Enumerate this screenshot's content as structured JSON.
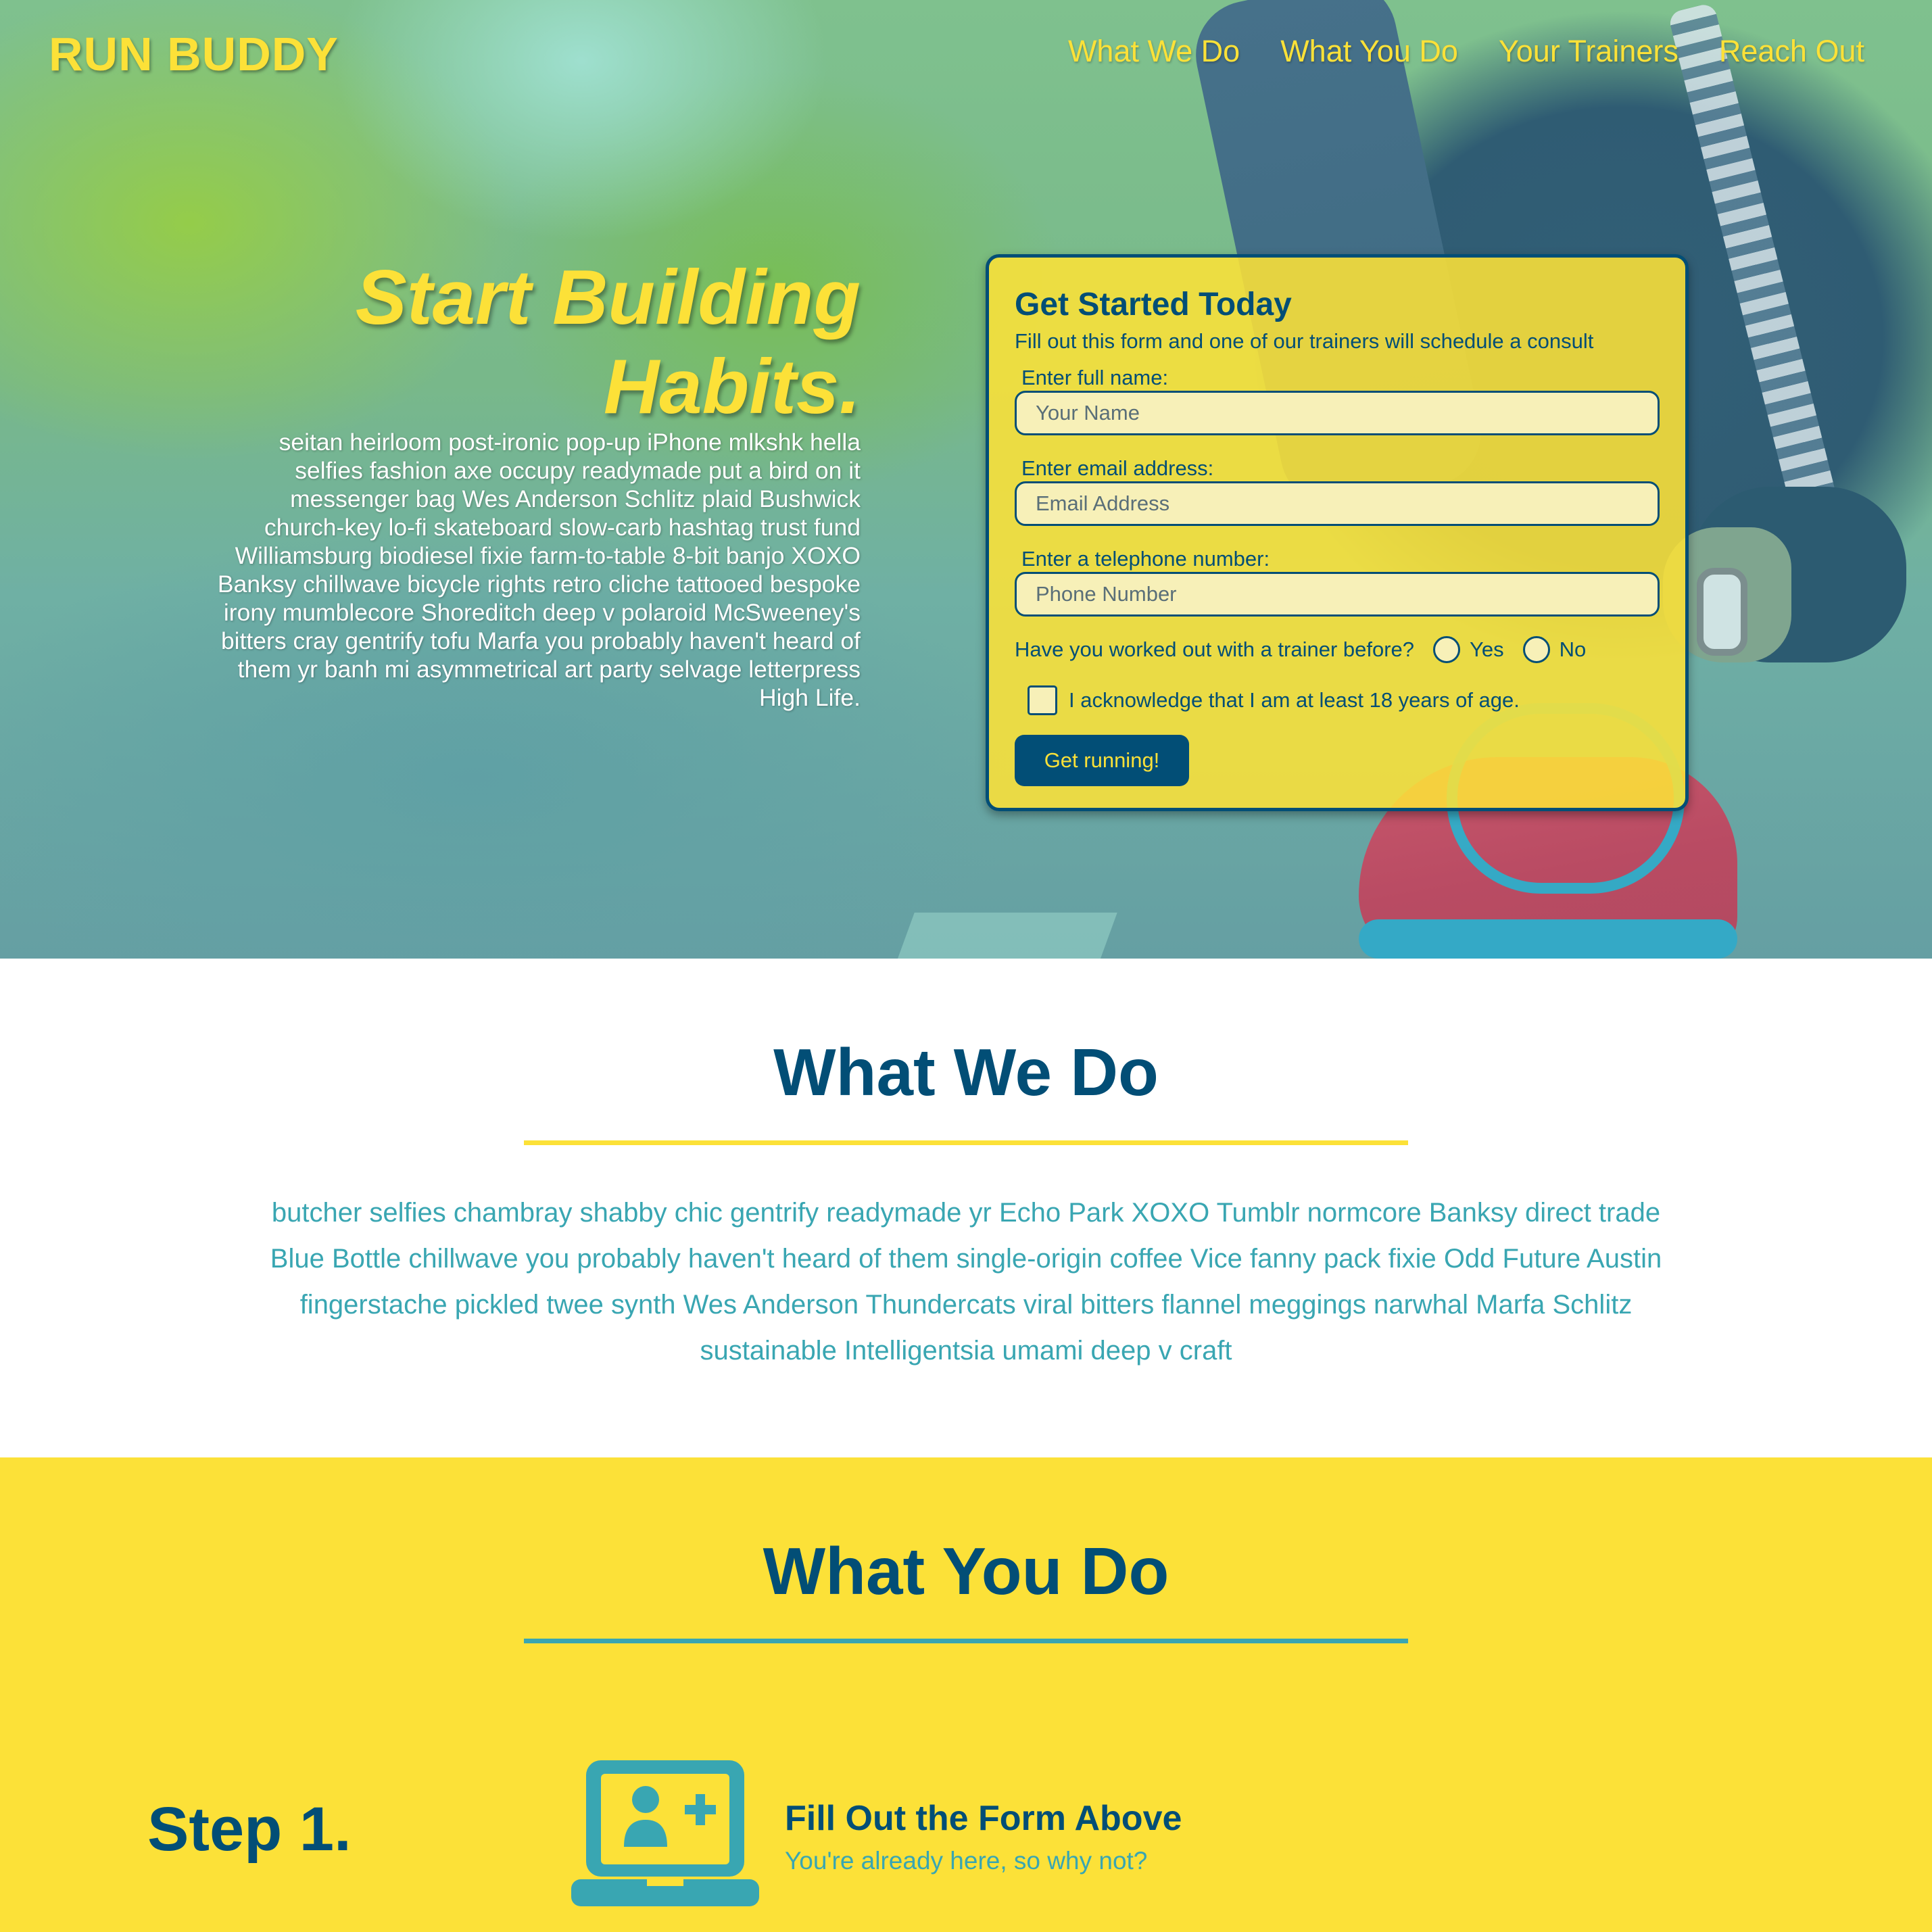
{
  "colors": {
    "primary": "#024e76",
    "accent": "#fce138",
    "teal": "#39a6b2"
  },
  "header": {
    "brand": "RUN BUDDY",
    "nav": [
      {
        "label": "What We Do"
      },
      {
        "label": "What You Do"
      },
      {
        "label": "Your Trainers"
      },
      {
        "label": "Reach Out"
      }
    ]
  },
  "hero": {
    "title_line1": "Start Building",
    "title_line2": "Habits.",
    "body": "seitan heirloom post-ironic pop-up iPhone mlkshk hella selfies fashion axe occupy readymade put a bird on it messenger bag Wes Anderson Schlitz plaid Bushwick church-key lo-fi skateboard slow-carb hashtag trust fund Williamsburg biodiesel fixie farm-to-table 8-bit banjo XOXO Banksy chillwave bicycle rights retro cliche tattooed bespoke irony mumblecore Shoreditch deep v polaroid McSweeney's bitters cray gentrify tofu Marfa you probably haven't heard of them yr banh mi asymmetrical art party selvage letterpress High Life."
  },
  "form": {
    "title": "Get Started Today",
    "subtitle": "Fill out this form and one of our trainers will schedule a consult",
    "name_label": "Enter full name:",
    "name_placeholder": "Your Name",
    "name_value": "",
    "email_label": "Enter email address:",
    "email_placeholder": "Email Address",
    "email_value": "",
    "phone_label": "Enter a telephone number:",
    "phone_placeholder": "Phone Number",
    "phone_value": "",
    "trainer_question": "Have you worked out with a trainer before?",
    "option_yes": "Yes",
    "option_no": "No",
    "age_ack": "I acknowledge that I am at least 18 years of age.",
    "submit": "Get running!"
  },
  "what_we_do": {
    "title": "What We Do",
    "body": "butcher selfies chambray shabby chic gentrify readymade yr Echo Park XOXO Tumblr normcore Banksy direct trade Blue Bottle chillwave you probably haven't heard of them single-origin coffee Vice fanny pack fixie Odd Future Austin fingerstache pickled twee synth Wes Anderson Thundercats viral bitters flannel meggings narwhal Marfa Schlitz sustainable Intelligentsia umami deep v craft"
  },
  "what_you_do": {
    "title": "What You Do",
    "steps": [
      {
        "label": "Step 1.",
        "icon": "laptop-add-user-icon",
        "title": "Fill Out the Form Above",
        "subtitle": "You're already here, so why not?"
      }
    ]
  }
}
